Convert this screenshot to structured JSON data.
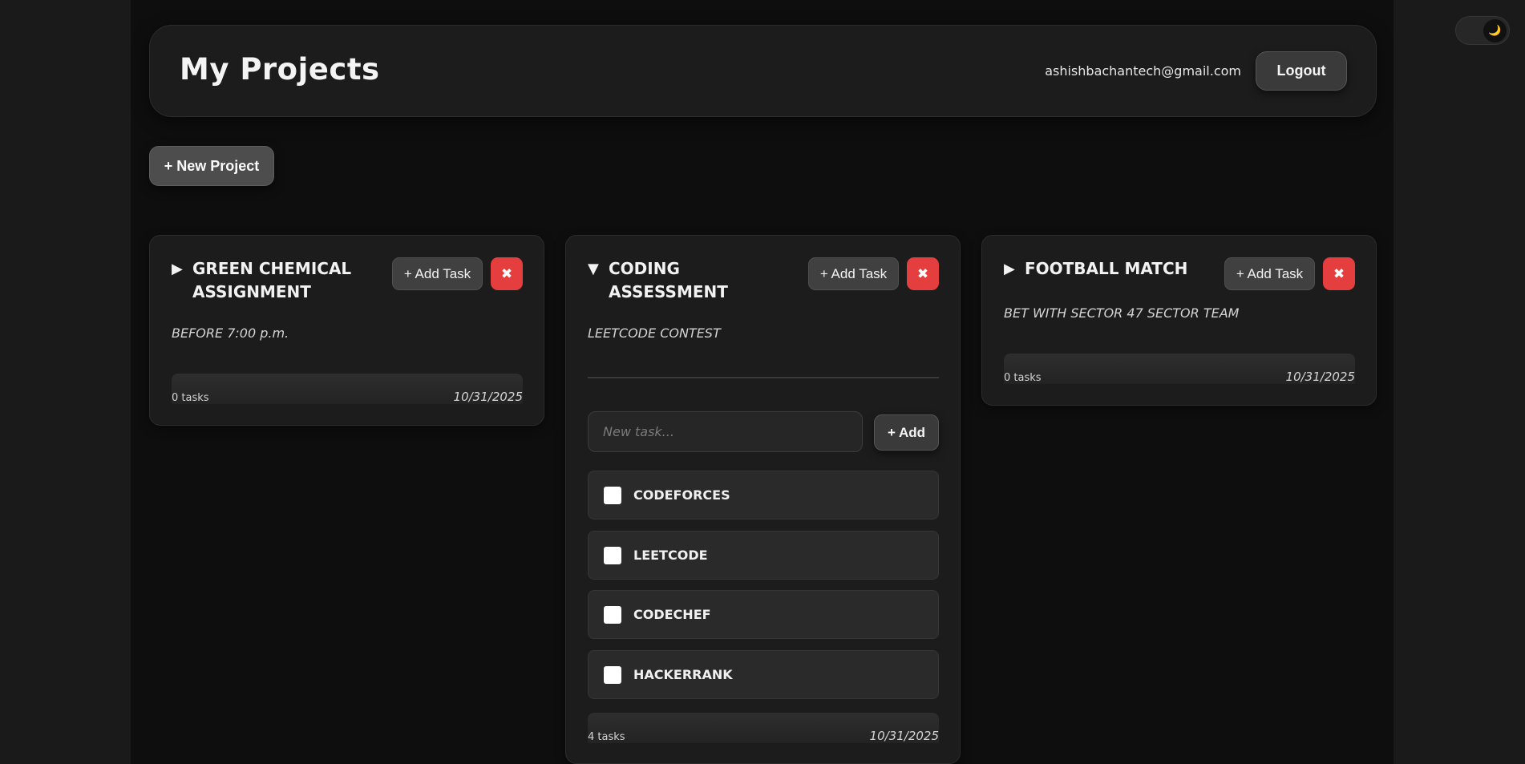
{
  "header": {
    "title": "My Projects",
    "user_email": "ashishbachantech@gmail.com",
    "logout_label": "Logout"
  },
  "new_project_label": "+ New Project",
  "theme_toggle": {
    "icon": "moon-icon",
    "glyph": "🌙"
  },
  "projects": [
    {
      "caret": "▶",
      "expanded": false,
      "title": "GREEN CHEMICAL ASSIGNMENT",
      "add_task_label": "+ Add Task",
      "delete_glyph": "✖",
      "description": "BEFORE 7:00 p.m.",
      "task_count": "0 tasks",
      "date": "10/31/2025"
    },
    {
      "caret": "▼",
      "expanded": true,
      "title": "CODING ASSESSMENT",
      "add_task_label": "+ Add Task",
      "delete_glyph": "✖",
      "description": "LEETCODE CONTEST",
      "new_task_placeholder": "New task...",
      "add_label": "+ Add",
      "tasks": [
        {
          "label": "CODEFORCES",
          "done": false
        },
        {
          "label": "LEETCODE",
          "done": false
        },
        {
          "label": "CODECHEF",
          "done": false
        },
        {
          "label": "HACKERRANK",
          "done": false
        }
      ],
      "task_count": "4 tasks",
      "date": "10/31/2025"
    },
    {
      "caret": "▶",
      "expanded": false,
      "title": "FOOTBALL MATCH",
      "add_task_label": "+ Add Task",
      "delete_glyph": "✖",
      "description": "BET WITH SECTOR 47 SECTOR TEAM",
      "task_count": "0 tasks",
      "date": "10/31/2025"
    }
  ]
}
